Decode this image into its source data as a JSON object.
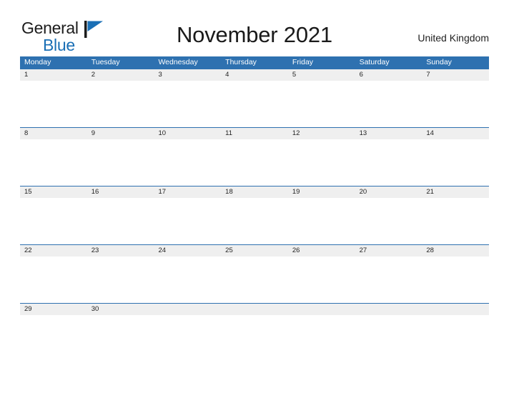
{
  "brand": {
    "name_part1": "General",
    "name_part2": "Blue",
    "flag_icon": "flag-icon",
    "color_dark": "#1c1c1c",
    "color_blue": "#1a6fb5"
  },
  "header": {
    "title": "November 2021",
    "country": "United Kingdom"
  },
  "theme": {
    "header_blue": "#2e71b0",
    "date_band_gray": "#efefef",
    "separator_blue": "#2e71b0",
    "text_dark": "#1f1f1f",
    "page_background": "#ffffff"
  },
  "calendar": {
    "month": "November",
    "year": "2021",
    "weekday_headers": [
      "Monday",
      "Tuesday",
      "Wednesday",
      "Thursday",
      "Friday",
      "Saturday",
      "Sunday"
    ],
    "weeks": [
      {
        "days": [
          "1",
          "2",
          "3",
          "4",
          "5",
          "6",
          "7"
        ]
      },
      {
        "days": [
          "8",
          "9",
          "10",
          "11",
          "12",
          "13",
          "14"
        ]
      },
      {
        "days": [
          "15",
          "16",
          "17",
          "18",
          "19",
          "20",
          "21"
        ]
      },
      {
        "days": [
          "22",
          "23",
          "24",
          "25",
          "26",
          "27",
          "28"
        ]
      },
      {
        "days": [
          "29",
          "30",
          "",
          "",
          "",
          "",
          ""
        ]
      }
    ]
  }
}
